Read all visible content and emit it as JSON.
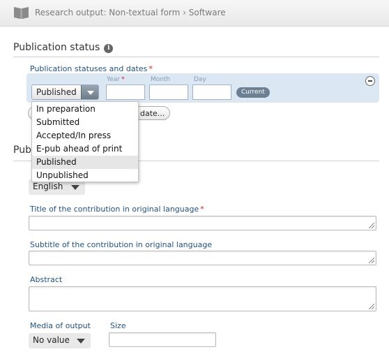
{
  "header": {
    "breadcrumb": "Research output: Non-textual form › Software"
  },
  "publication_status": {
    "section_title": "Publication status",
    "statuses_label": "Publication statuses and dates",
    "required_mark": "*",
    "selected_status": "Published",
    "year_label": "Year",
    "month_label": "Month",
    "day_label": "Day",
    "year_value": "",
    "month_value": "",
    "day_value": "",
    "current_badge": "Current",
    "add_button_label": "date...",
    "dropdown_options": [
      "In preparation",
      "Submitted",
      "Accepted/In press",
      "E-pub ahead of print",
      "Published",
      "Unpublished"
    ],
    "highlighted_option": "Published"
  },
  "publication": {
    "section_title_partial": "Publi",
    "language_value": "English",
    "title_label": "Title of the contribution in original language",
    "title_value": "",
    "subtitle_label": "Subtitle of the contribution in original language",
    "subtitle_value": "",
    "abstract_label": "Abstract",
    "abstract_value": "",
    "media_label": "Media of output",
    "media_value": "No value",
    "size_label": "Size",
    "size_value": ""
  },
  "colors": {
    "label_blue": "#23527c",
    "required_red": "#d02020",
    "status_row_bg": "#dce7f4",
    "badge_bg": "#6c7f93"
  }
}
